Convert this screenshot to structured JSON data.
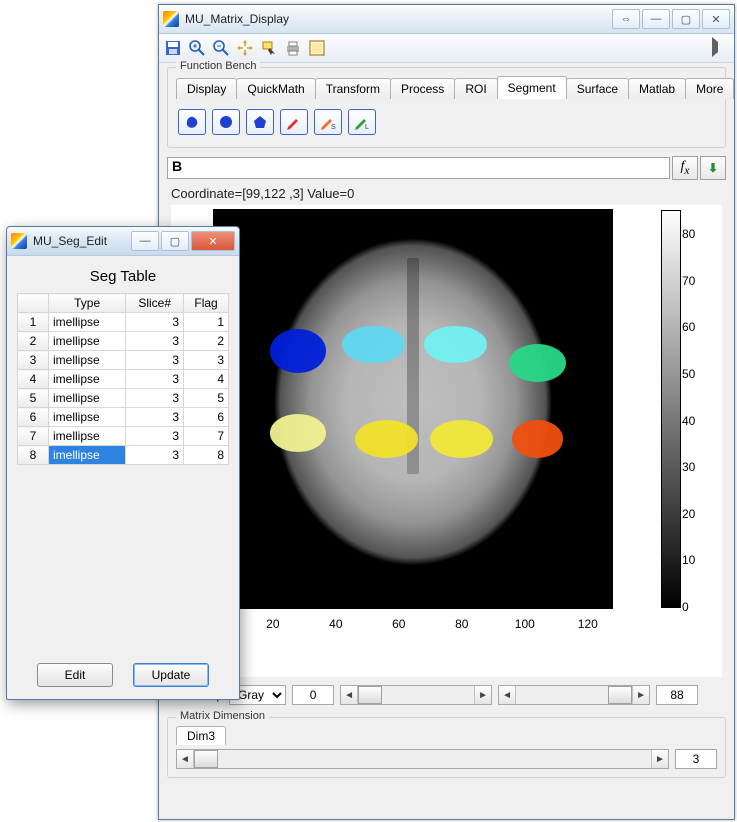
{
  "main_window": {
    "title": "MU_Matrix_Display",
    "window_buttons": [
      "undock",
      "min",
      "max",
      "close"
    ]
  },
  "toolbar": {
    "items": [
      "save",
      "zoom-in",
      "zoom-out",
      "pan",
      "data-cursor",
      "print",
      "layout"
    ]
  },
  "function_bench": {
    "legend": "Function Bench",
    "tabs": [
      "Display",
      "QuickMath",
      "Transform",
      "Process",
      "ROI",
      "Segment",
      "Surface",
      "Matlab",
      "More"
    ],
    "active_tab": "Segment",
    "seg_tools": [
      "blob",
      "circle",
      "polygon",
      "pencil-red",
      "pencil-orange-S",
      "pencil-green-L"
    ]
  },
  "formula": {
    "value": "B",
    "fx_label": "fx",
    "download_glyph": "⬇"
  },
  "coordinate_text": "Coordinate=[99,122  ,3] Value=0",
  "chart_data": {
    "type": "heatmap",
    "title": "",
    "xlabel": "",
    "ylabel": "",
    "x_ticks": [
      20,
      40,
      60,
      80,
      100,
      120
    ],
    "colorbar_ticks": [
      0,
      10,
      20,
      30,
      40,
      50,
      60,
      70,
      80
    ],
    "xlim": [
      1,
      128
    ],
    "ylim": [
      1,
      128
    ],
    "colorbar_range": [
      0,
      85
    ],
    "rois": [
      {
        "id": 1,
        "cx": 28,
        "cy": 46,
        "rx": 9,
        "ry": 7,
        "color": "#0020d8"
      },
      {
        "id": 2,
        "cx": 52,
        "cy": 44,
        "rx": 10,
        "ry": 6,
        "color": "#5fd8f0"
      },
      {
        "id": 3,
        "cx": 78,
        "cy": 44,
        "rx": 10,
        "ry": 6,
        "color": "#70f0f0"
      },
      {
        "id": 4,
        "cx": 104,
        "cy": 50,
        "rx": 9,
        "ry": 6,
        "color": "#28d888"
      },
      {
        "id": 5,
        "cx": 28,
        "cy": 72,
        "rx": 9,
        "ry": 6,
        "color": "#f0f090"
      },
      {
        "id": 6,
        "cx": 56,
        "cy": 74,
        "rx": 10,
        "ry": 6,
        "color": "#f0e028"
      },
      {
        "id": 7,
        "cx": 80,
        "cy": 74,
        "rx": 10,
        "ry": 6,
        "color": "#f0e838"
      },
      {
        "id": 8,
        "cx": 104,
        "cy": 74,
        "rx": 8,
        "ry": 6,
        "color": "#f05010"
      }
    ]
  },
  "color_controls": {
    "colormap_label": "Colormap",
    "colormap_value": "Gray",
    "low_value": "0",
    "high_value": "88"
  },
  "matrix_dimension": {
    "legend": "Matrix Dimension",
    "tab_label": "Dim3",
    "value": "3"
  },
  "seg_window": {
    "title": "MU_Seg_Edit",
    "heading": "Seg Table",
    "columns": [
      "Type",
      "Slice#",
      "Flag"
    ],
    "rows": [
      {
        "n": 1,
        "type": "imellipse",
        "slice": 3,
        "flag": 1
      },
      {
        "n": 2,
        "type": "imellipse",
        "slice": 3,
        "flag": 2
      },
      {
        "n": 3,
        "type": "imellipse",
        "slice": 3,
        "flag": 3
      },
      {
        "n": 4,
        "type": "imellipse",
        "slice": 3,
        "flag": 4
      },
      {
        "n": 5,
        "type": "imellipse",
        "slice": 3,
        "flag": 5
      },
      {
        "n": 6,
        "type": "imellipse",
        "slice": 3,
        "flag": 6
      },
      {
        "n": 7,
        "type": "imellipse",
        "slice": 3,
        "flag": 7
      },
      {
        "n": 8,
        "type": "imellipse",
        "slice": 3,
        "flag": 8
      }
    ],
    "selected_row": 8,
    "edit_label": "Edit",
    "update_label": "Update"
  }
}
